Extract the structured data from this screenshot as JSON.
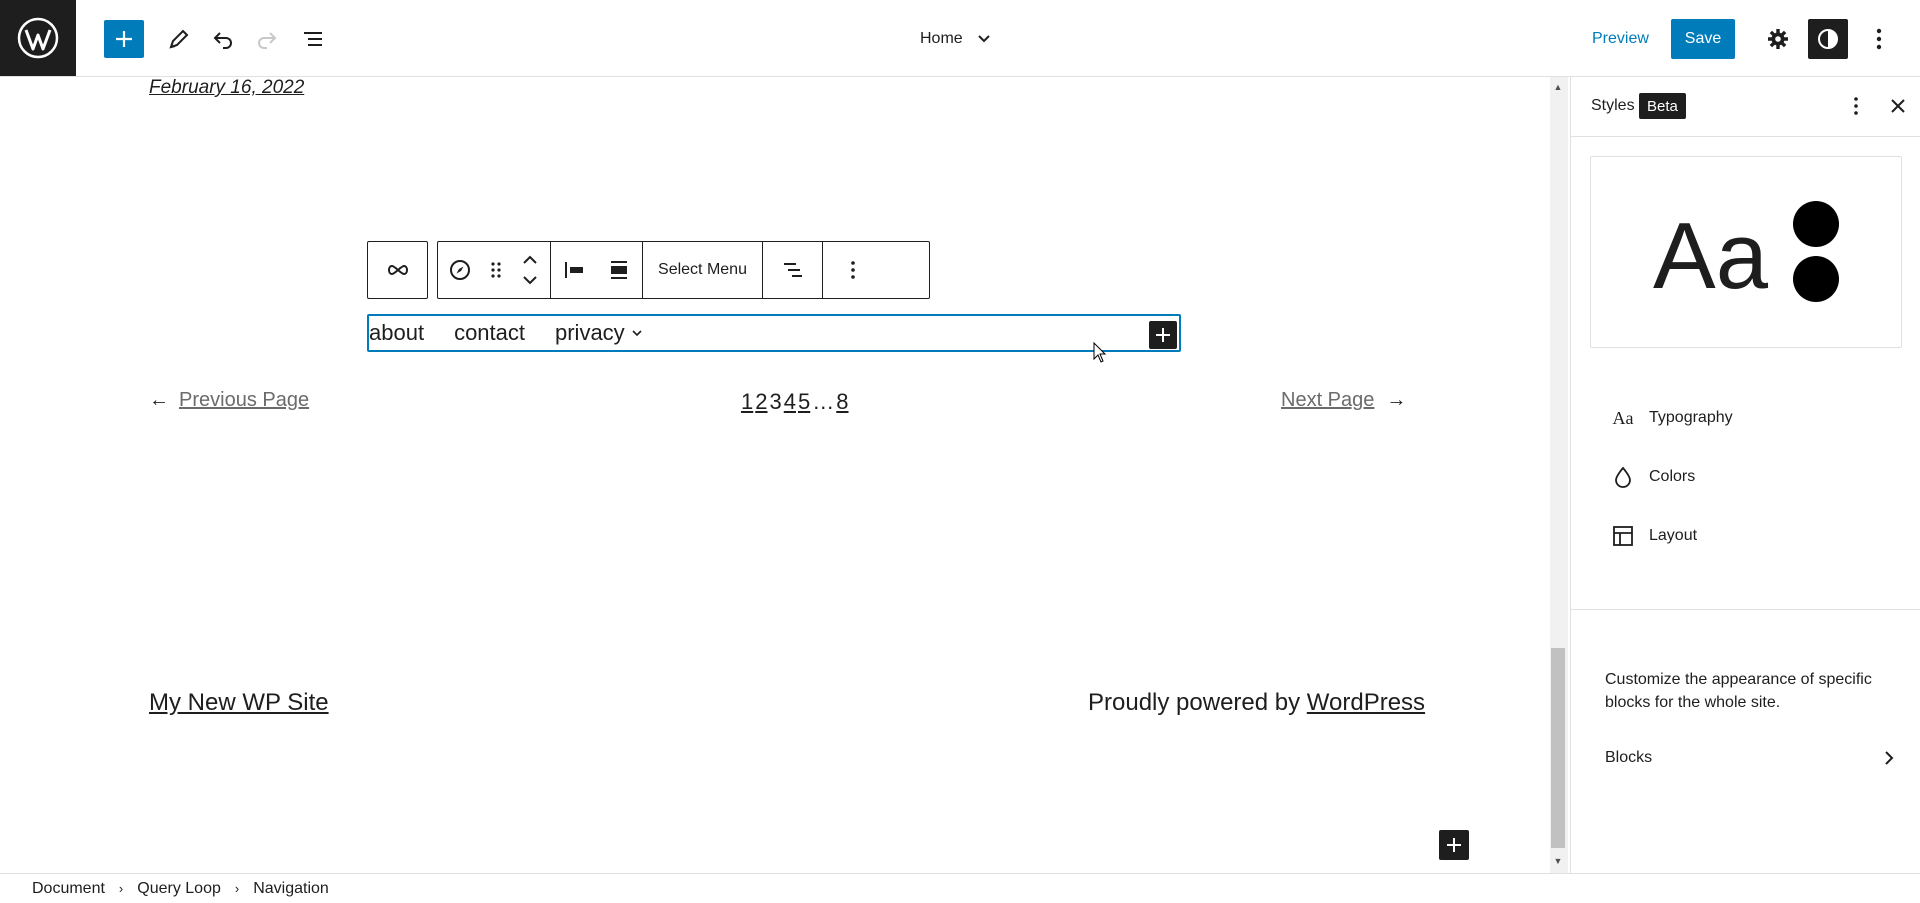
{
  "header": {
    "document_title": "Home",
    "preview_label": "Preview",
    "save_label": "Save"
  },
  "canvas": {
    "post_date": "February 16, 2022",
    "block_toolbar": {
      "select_menu_label": "Select Menu"
    },
    "nav_items": [
      {
        "label": "about"
      },
      {
        "label": "contact"
      },
      {
        "label": "privacy"
      }
    ],
    "pagination": {
      "previous_label": "Previous Page",
      "next_label": "Next Page",
      "previous_arrow": "←",
      "next_arrow": "→",
      "pages": [
        "1",
        "2",
        "3",
        "4",
        "5",
        "…",
        "8"
      ],
      "current_page": "3"
    },
    "footer": {
      "site_title": "My New WP Site",
      "powered_text": "Proudly powered by ",
      "powered_link": "WordPress"
    }
  },
  "sidebar": {
    "title": "Styles",
    "badge": "Beta",
    "preview_text": "Aa",
    "menu": [
      {
        "label": "Typography",
        "icon": "typography-icon"
      },
      {
        "label": "Colors",
        "icon": "droplet-icon"
      },
      {
        "label": "Layout",
        "icon": "layout-icon"
      }
    ],
    "description": "Customize the appearance of specific blocks for the whole site.",
    "blocks_label": "Blocks"
  },
  "breadcrumbs": [
    "Document",
    "Query Loop",
    "Navigation"
  ],
  "colors": {
    "accent": "#007cba",
    "dark": "#1e1e1e"
  }
}
